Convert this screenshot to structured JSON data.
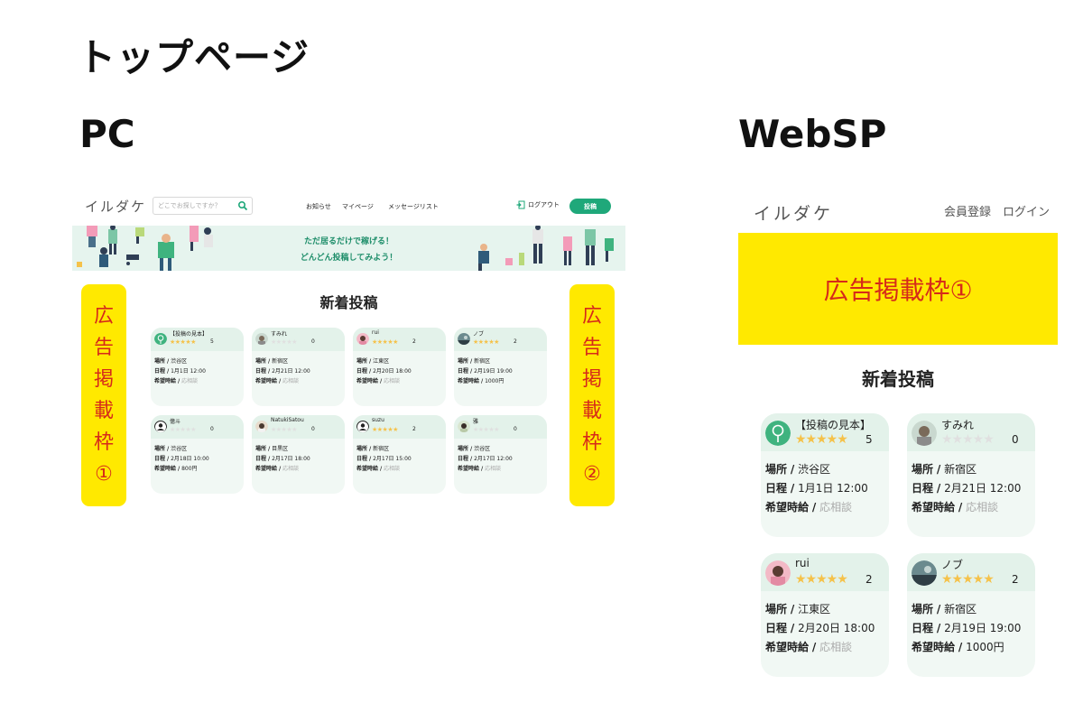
{
  "page_title": "トップページ",
  "pc": {
    "label": "PC",
    "logo": "イルダケ",
    "search_placeholder": "どこでお探しですか？",
    "nav": [
      "お知らせ",
      "マイページ",
      "メッセージリスト"
    ],
    "logout": "ログアウト",
    "post_button": "投稿",
    "banner_line1": "ただ居るだけで稼げる！",
    "banner_line2": "どんどん投稿してみよう！",
    "ad_left": [
      "広",
      "告",
      "掲",
      "載",
      "枠",
      "①"
    ],
    "ad_right": [
      "広",
      "告",
      "掲",
      "載",
      "枠",
      "②"
    ],
    "heading": "新着投稿",
    "labels": {
      "place": "場所",
      "date": "日程",
      "wage": "希望時給",
      "sep": "/"
    },
    "cards": [
      {
        "name": "【投稿の見本】",
        "stars": "★★★★★",
        "rating": "5",
        "place": "渋谷区",
        "date": "1月1日 12:00",
        "wage": "応相談"
      },
      {
        "name": "すみれ",
        "stars": "★★★★★",
        "rating": "0",
        "place": "新宿区",
        "date": "2月21日 12:00",
        "wage": "応相談"
      },
      {
        "name": "rui",
        "stars": "★★★★★",
        "rating": "2",
        "place": "江東区",
        "date": "2月20日 18:00",
        "wage": "応相談"
      },
      {
        "name": "ノブ",
        "stars": "★★★★★",
        "rating": "2",
        "place": "新宿区",
        "date": "2月19日 19:00",
        "wage": "1000円"
      },
      {
        "name": "億斗",
        "stars": "★★★★★",
        "rating": "0",
        "place": "渋谷区",
        "date": "2月18日 10:00",
        "wage": "800円"
      },
      {
        "name": "NatukiSatou",
        "stars": "★★★★★",
        "rating": "0",
        "place": "目黒区",
        "date": "2月17日 18:00",
        "wage": "応相談"
      },
      {
        "name": "suzu",
        "stars": "★★★★★",
        "rating": "2",
        "place": "新宿区",
        "date": "2月17日 15:00",
        "wage": "応相談"
      },
      {
        "name": "雅",
        "stars": "★★★★★",
        "rating": "0",
        "place": "渋谷区",
        "date": "2月17日 12:00",
        "wage": "応相談"
      }
    ]
  },
  "sp": {
    "label": "WebSP",
    "logo": "イルダケ",
    "register": "会員登録",
    "login": "ログイン",
    "ad": "広告掲載枠①",
    "heading": "新着投稿",
    "labels": {
      "place": "場所",
      "date": "日程",
      "wage": "希望時給",
      "sep": "/"
    },
    "cards": [
      {
        "name": "【投稿の見本】",
        "stars": "★★★★★",
        "rating": "5",
        "place": "渋谷区",
        "date": "1月1日 12:00",
        "wage": "応相談"
      },
      {
        "name": "すみれ",
        "stars": "★★★★★",
        "rating": "0",
        "place": "新宿区",
        "date": "2月21日 12:00",
        "wage": "応相談"
      },
      {
        "name": "rui",
        "stars": "★★★★★",
        "rating": "2",
        "place": "江東区",
        "date": "2月20日 18:00",
        "wage": "応相談"
      },
      {
        "name": "ノブ",
        "stars": "★★★★★",
        "rating": "2",
        "place": "新宿区",
        "date": "2月19日 19:00",
        "wage": "1000円"
      }
    ]
  },
  "colors": {
    "accent": "#1fa87a",
    "ad_yellow": "#ffe900",
    "ad_text": "#d62a1a",
    "star": "#f5c24a"
  }
}
